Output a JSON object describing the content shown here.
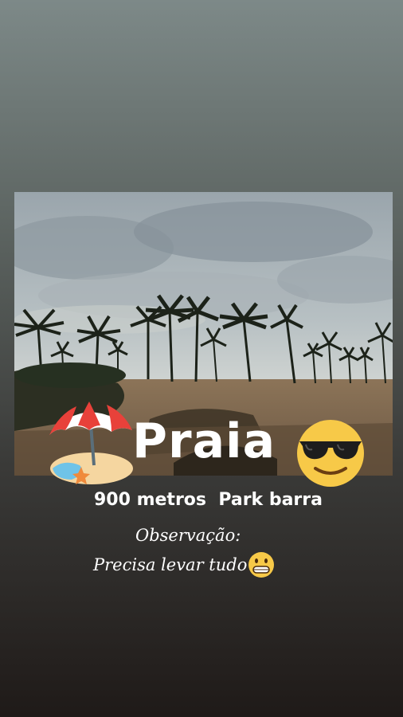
{
  "story": {
    "title": "Praia",
    "distance": "900 metros  Park barra",
    "observation_label": "Observação:",
    "observation_note": "Precisa levar tudo",
    "icons": [
      "beach-umbrella-icon",
      "sunglasses-face-icon",
      "grinning-face-icon"
    ]
  },
  "colors": {
    "text": "#ffffff",
    "emoji_yellow": "#f7c948"
  }
}
